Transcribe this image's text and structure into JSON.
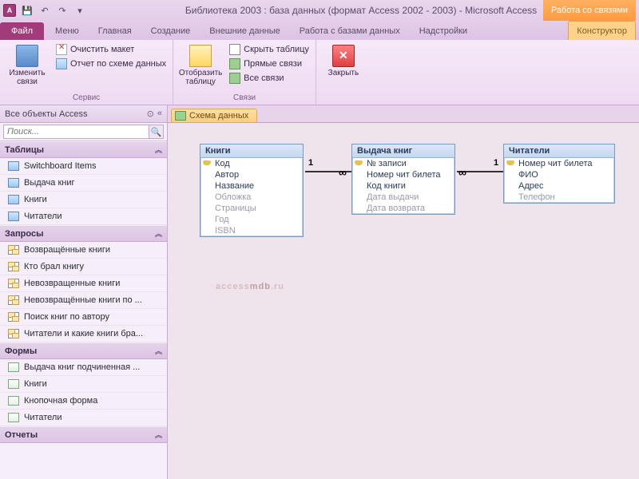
{
  "title": "Библиотека 2003 : база данных (формат Access 2002 - 2003)  -  Microsoft Access",
  "context_group": "Работа со связями",
  "tabs": {
    "file": "Файл",
    "items": [
      "Меню",
      "Главная",
      "Создание",
      "Внешние данные",
      "Работа с базами данных",
      "Надстройки"
    ],
    "context": "Конструктор"
  },
  "ribbon": {
    "g1": {
      "big": "Изменить связи",
      "clear": "Очистить макет",
      "report": "Отчет по схеме данных",
      "title": "Сервис"
    },
    "g2": {
      "big": "Отобразить таблицу",
      "hide": "Скрыть таблицу",
      "direct": "Прямые связи",
      "all": "Все связи",
      "title": "Связи"
    },
    "g3": {
      "close": "Закрыть"
    }
  },
  "nav": {
    "header": "Все объекты Access",
    "search_placeholder": "Поиск...",
    "sections": {
      "tables": "Таблицы",
      "queries": "Запросы",
      "forms": "Формы",
      "reports": "Отчеты"
    },
    "tables": [
      "Switchboard Items",
      "Выдача книг",
      "Книги",
      "Читатели"
    ],
    "queries": [
      "Возвращённые книги",
      "Кто брал книгу",
      "Невозвращенные книги",
      "Невозвращённые книги по ...",
      "Поиск книг по автору",
      "Читатели и какие книги бра..."
    ],
    "forms": [
      "Выдача книг подчиненная ...",
      "Книги",
      "Кнопочная форма",
      "Читатели"
    ]
  },
  "doc_tab": "Схема данных",
  "rel": {
    "t1": {
      "title": "Книги",
      "fields": [
        "Код",
        "Автор",
        "Название",
        "Обложка",
        "Страницы",
        "Год",
        "ISBN"
      ],
      "keys": [
        0
      ],
      "grey": [
        3,
        4,
        5,
        6
      ]
    },
    "t2": {
      "title": "Выдача книг",
      "fields": [
        "№ записи",
        "Номер чит билета",
        "Код книги",
        "Дата выдачи",
        "Дата возврата"
      ],
      "keys": [
        0
      ],
      "grey": [
        3,
        4
      ]
    },
    "t3": {
      "title": "Читатели",
      "fields": [
        "Номер чит билета",
        "ФИО",
        "Адрес",
        "Телефон"
      ],
      "keys": [
        0
      ],
      "grey": [
        3
      ]
    }
  },
  "watermark": "accessmdb.ru"
}
